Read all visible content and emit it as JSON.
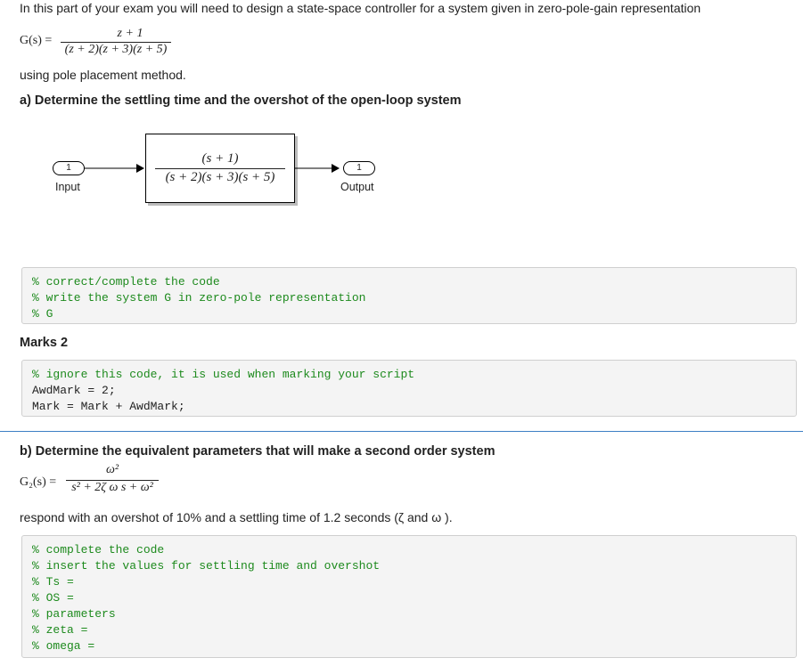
{
  "intro": "In this part of your exam you will need to design a state-space controller for a system given in zero-pole-gain representation",
  "g_eq": {
    "lhs": "G(s) =",
    "num": "z + 1",
    "den": "(z + 2)(z + 3)(z + 5)"
  },
  "method": "using pole placement method.",
  "part_a": {
    "heading": "a) Determine the settling time and the overshot of the open-loop system",
    "diagram": {
      "input_port": "1",
      "input_label": "Input",
      "tf_num": "(s + 1)",
      "tf_den": "(s + 2)(s + 3)(s + 5)",
      "output_port": "1",
      "output_label": "Output"
    },
    "code": [
      "% correct/complete the code",
      "% write the system G in zero-pole representation",
      "% G"
    ],
    "marks": "Marks 2",
    "marking_code": [
      "% ignore this code, it is used when marking your script",
      "AwdMark = 2;",
      "Mark = Mark + AwdMark;"
    ]
  },
  "part_b": {
    "heading": "b) Determine the equivalent parameters that will make a second order system",
    "g2_eq": {
      "lhs": "G₂(s) =",
      "num": "ω²",
      "den": "s² + 2ζ ω s + ω²"
    },
    "respond": "respond with an overshot of 10% and a settling time of 1.2 seconds (ζ and ω ).",
    "code": [
      "% complete the code",
      "% insert the values for settling time and overshot",
      "% Ts =",
      "% OS =",
      "% parameters",
      "% zeta =",
      "% omega ="
    ]
  }
}
